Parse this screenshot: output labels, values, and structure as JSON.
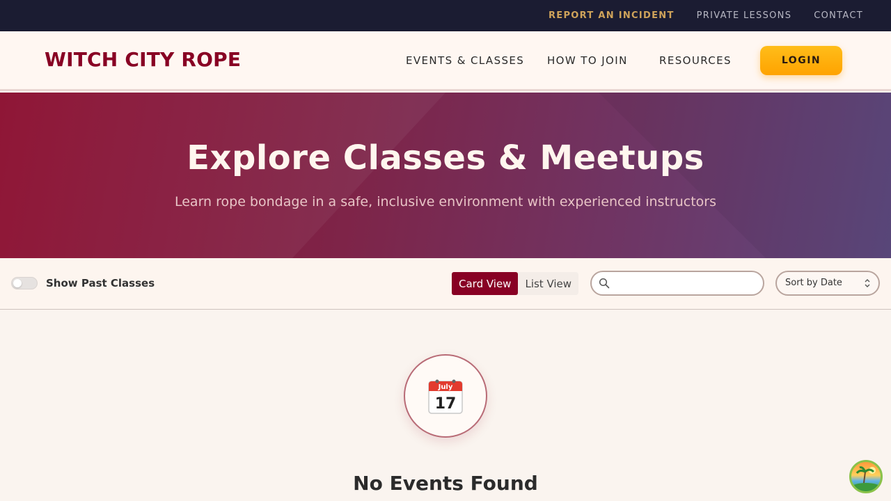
{
  "utility_bar": {
    "links": [
      "REPORT AN INCIDENT",
      "PRIVATE LESSONS",
      "CONTACT"
    ]
  },
  "header": {
    "logo": "WITCH CITY ROPE",
    "nav": [
      "EVENTS & CLASSES",
      "HOW TO JOIN",
      "RESOURCES"
    ],
    "login_label": "LOGIN"
  },
  "hero": {
    "title": "Explore Classes & Meetups",
    "subtitle": "Learn rope bondage in a safe, inclusive environment with experienced instructors"
  },
  "filters": {
    "show_past_label": "Show Past Classes",
    "show_past_checked": false,
    "view_options": [
      "Card View",
      "List View"
    ],
    "active_view": "Card View",
    "search_value": "",
    "search_placeholder": "",
    "sort_label": "Sort by Date"
  },
  "empty_state": {
    "calendar_month": "July",
    "calendar_day": "17",
    "title": "No Events Found"
  },
  "colors": {
    "brand": "#880124",
    "utility_bg": "#1b1c32",
    "accent_gold": "#ffbd1a",
    "incident_link": "#cfa35a"
  },
  "icons": {
    "search": "search-icon",
    "sort": "chevron-updown-icon",
    "calendar": "calendar-icon",
    "avatar": "beach-avatar-icon"
  }
}
